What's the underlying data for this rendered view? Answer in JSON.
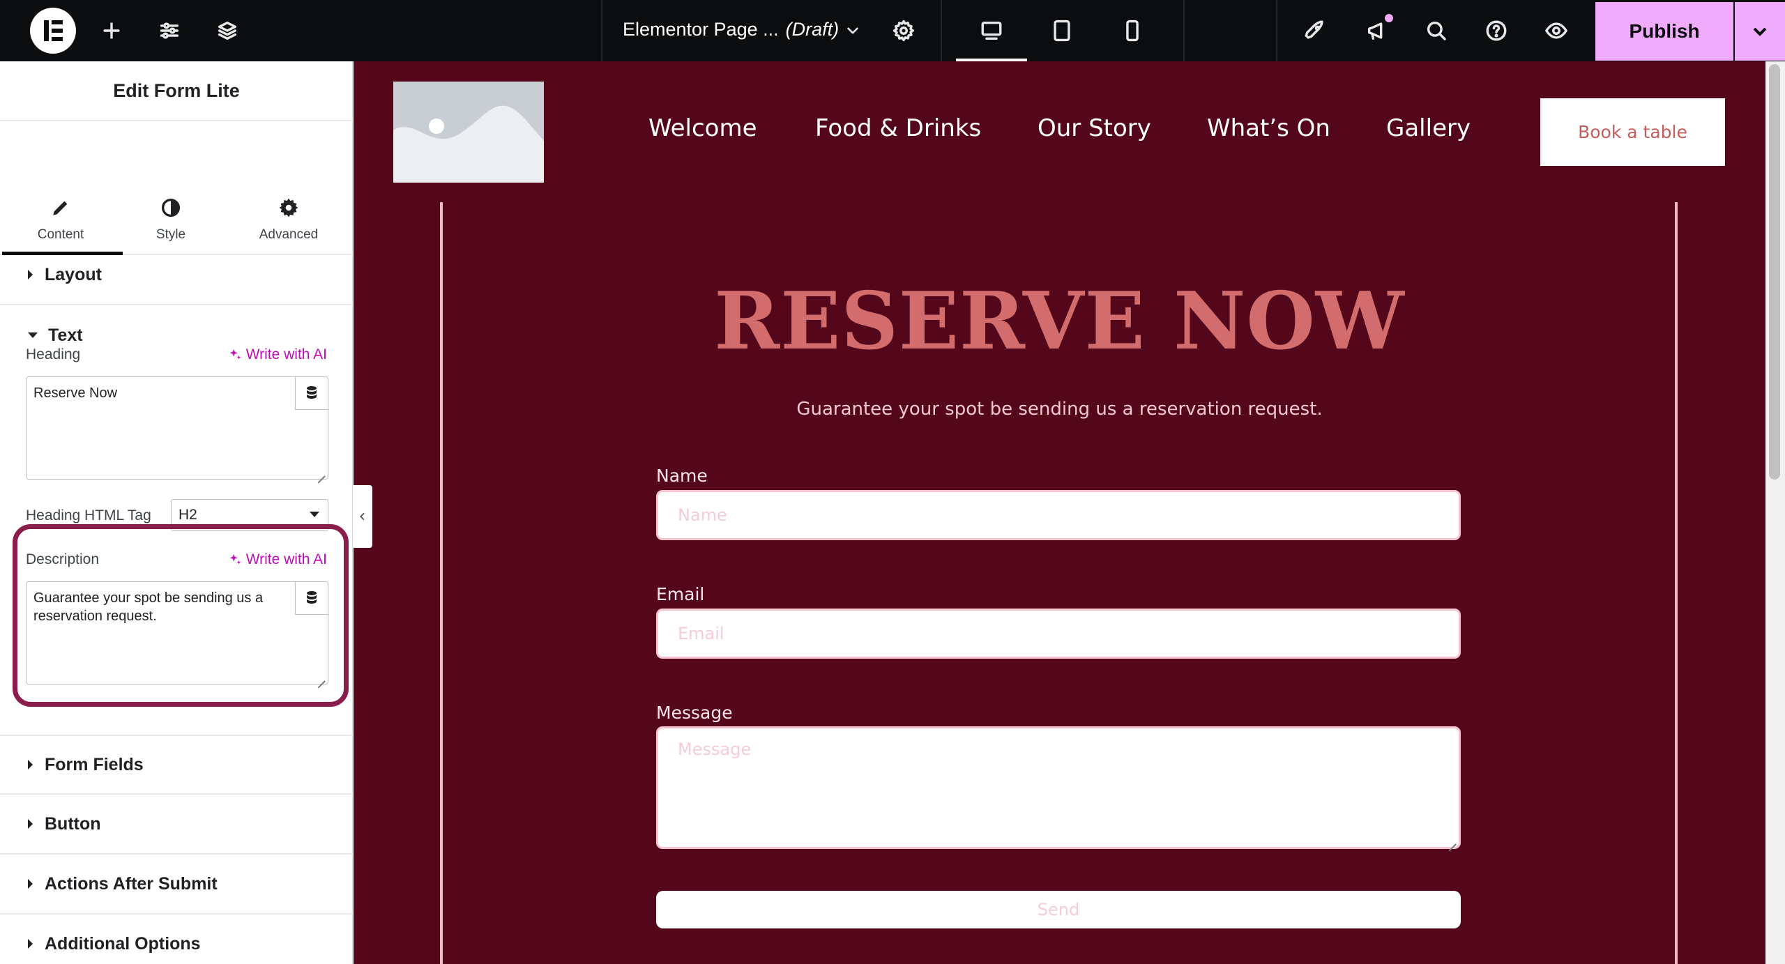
{
  "topbar": {
    "page_title": "Elementor Page ...",
    "status": "(Draft)",
    "publish_label": "Publish"
  },
  "panel": {
    "title": "Edit Form Lite",
    "tabs": [
      {
        "label": "Content",
        "icon": "pencil-icon"
      },
      {
        "label": "Style",
        "icon": "half-circle-icon"
      },
      {
        "label": "Advanced",
        "icon": "gear-icon"
      }
    ],
    "sections": {
      "layout": "Layout",
      "text": "Text",
      "form_fields": "Form Fields",
      "button": "Button",
      "actions_after_submit": "Actions After Submit",
      "additional_options": "Additional Options"
    },
    "heading_label": "Heading",
    "heading_value": "Reserve Now",
    "write_ai": "Write with AI",
    "heading_tag_label": "Heading HTML Tag",
    "heading_tag_value": "H2",
    "description_label": "Description",
    "description_value": "Guarantee your spot be sending us a reservation request."
  },
  "preview": {
    "nav": [
      "Welcome",
      "Food & Drinks",
      "Our Story",
      "What’s On",
      "Gallery"
    ],
    "book_button": "Book a table",
    "heading": "RESERVE NOW",
    "subheading": "Guarantee your spot be sending us a reservation request.",
    "form": {
      "name_label": "Name",
      "name_placeholder": "Name",
      "email_label": "Email",
      "email_placeholder": "Email",
      "message_label": "Message",
      "message_placeholder": "Message",
      "send_label": "Send"
    }
  },
  "colors": {
    "canvas_bg": "#54061b",
    "heading": "#d36c6c",
    "publish_bg": "#f0abfc",
    "ai_link": "#c00bb9",
    "highlight": "#8a1d4b"
  }
}
